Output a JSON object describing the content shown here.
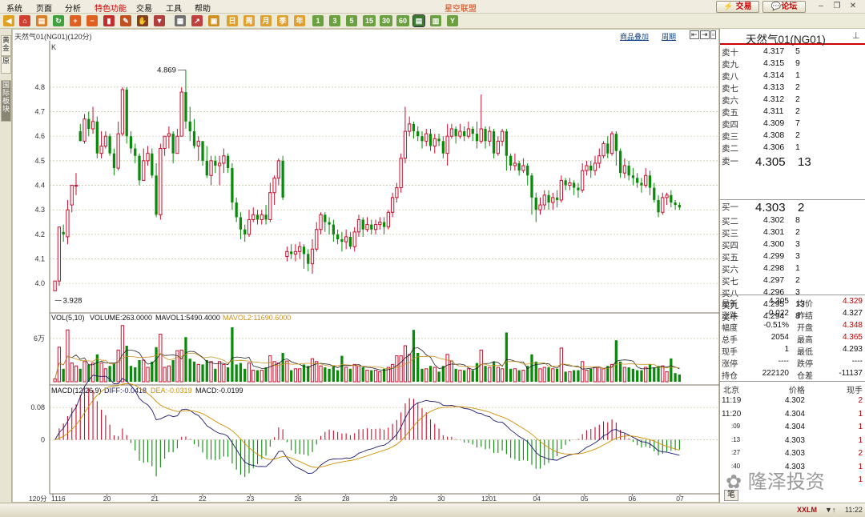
{
  "menu": [
    "系统",
    "页面",
    "分析",
    "特色功能",
    "交易",
    "工具",
    "帮助"
  ],
  "app_title": "星空联盟",
  "top_buttons": {
    "trade": "交易",
    "forum": "论坛"
  },
  "left_tabs": [
    "黄金",
    "原",
    "国际板块"
  ],
  "chart_header": {
    "title": "天然气01(NG01)(120分)",
    "overlay": "商品叠加",
    "period": "周期"
  },
  "toolbar_numbers": [
    "1",
    "3",
    "5",
    "15",
    "30",
    "60"
  ],
  "colors": {
    "up": "#c8102e",
    "down": "#0a8a0a",
    "bg": "#ffffff",
    "grid": "#c9c09a",
    "axis": "#7a7460"
  },
  "chart_data": [
    {
      "type": "candlestick",
      "title": "K",
      "ylim": [
        3.88,
        4.93
      ],
      "yticks": [
        4.0,
        4.1,
        4.2,
        4.3,
        4.4,
        4.5,
        4.6,
        4.7,
        4.8
      ],
      "annotations": {
        "high": "4.869",
        "low": "3.928"
      },
      "x_labels": [
        "1116",
        "20",
        "21",
        "22",
        "23",
        "26",
        "28",
        "29",
        "30",
        "1201",
        "04",
        "05",
        "06",
        "07"
      ],
      "bottom_label": "120分",
      "candles": [
        [
          3.97,
          4.01,
          3.93,
          3.93
        ],
        [
          4.01,
          4.23,
          3.99,
          4.21
        ],
        [
          4.21,
          4.2,
          4.17,
          4.24
        ],
        [
          4.19,
          4.3,
          4.16,
          4.34
        ],
        [
          4.32,
          4.4,
          4.29,
          4.4
        ],
        [
          4.4,
          4.4,
          4.36,
          4.45
        ],
        [
          4.62,
          4.58,
          4.58,
          4.65
        ],
        [
          4.58,
          4.67,
          4.57,
          4.69
        ],
        [
          4.67,
          4.63,
          4.6,
          4.7
        ],
        [
          4.63,
          4.66,
          4.61,
          4.72
        ],
        [
          4.66,
          4.53,
          4.51,
          4.68
        ],
        [
          4.53,
          4.56,
          4.51,
          4.62
        ],
        [
          4.56,
          4.6,
          4.55,
          4.62
        ],
        [
          4.6,
          4.53,
          4.52,
          4.61
        ],
        [
          4.53,
          4.47,
          4.44,
          4.55
        ],
        [
          4.47,
          4.61,
          4.46,
          4.66
        ],
        [
          4.61,
          4.79,
          4.6,
          4.8
        ],
        [
          4.79,
          4.6,
          4.57,
          4.8
        ],
        [
          4.6,
          4.55,
          4.53,
          4.62
        ],
        [
          4.55,
          4.52,
          4.49,
          4.57
        ],
        [
          4.52,
          4.42,
          4.4,
          4.53
        ],
        [
          4.42,
          4.5,
          4.42,
          4.55
        ],
        [
          4.5,
          4.53,
          4.48,
          4.56
        ],
        [
          4.53,
          4.44,
          4.43,
          4.55
        ],
        [
          4.44,
          4.28,
          4.27,
          4.49
        ],
        [
          4.28,
          4.55,
          4.26,
          4.57
        ],
        [
          4.55,
          4.6,
          4.52,
          4.6
        ],
        [
          4.6,
          4.61,
          4.55,
          4.64
        ],
        [
          4.61,
          4.53,
          4.49,
          4.62
        ],
        [
          4.53,
          4.6,
          4.53,
          4.63
        ],
        [
          4.6,
          4.78,
          4.6,
          4.8
        ],
        [
          4.78,
          4.66,
          4.63,
          4.87
        ],
        [
          4.66,
          4.62,
          4.58,
          4.72
        ],
        [
          4.62,
          4.56,
          4.55,
          4.67
        ],
        [
          4.56,
          4.58,
          4.5,
          4.6
        ],
        [
          4.58,
          4.5,
          4.48,
          4.58
        ],
        [
          4.5,
          4.44,
          4.43,
          4.56
        ],
        [
          4.44,
          4.5,
          4.4,
          4.52
        ],
        [
          4.5,
          4.48,
          4.45,
          4.52
        ],
        [
          4.48,
          4.49,
          4.4,
          4.52
        ],
        [
          4.49,
          4.52,
          4.45,
          4.55
        ],
        [
          4.52,
          4.47,
          4.45,
          4.53
        ],
        [
          4.47,
          4.33,
          4.3,
          4.49
        ],
        [
          4.33,
          4.27,
          4.25,
          4.35
        ],
        [
          4.27,
          4.22,
          4.18,
          4.29
        ],
        [
          4.22,
          4.2,
          4.17,
          4.24
        ],
        [
          4.2,
          4.26,
          4.19,
          4.3
        ],
        [
          4.26,
          4.28,
          4.25,
          4.31
        ],
        [
          4.28,
          4.26,
          4.24,
          4.3
        ],
        [
          4.26,
          4.28,
          4.24,
          4.3
        ],
        [
          4.28,
          4.26,
          4.24,
          4.32
        ],
        [
          4.26,
          4.37,
          4.25,
          4.41
        ],
        [
          4.37,
          4.43,
          4.32,
          4.44
        ],
        [
          4.43,
          4.5,
          4.4,
          4.51
        ],
        [
          4.5,
          4.35,
          4.34,
          4.52
        ],
        [
          4.11,
          4.13,
          4.09,
          4.15
        ],
        [
          4.13,
          4.12,
          4.1,
          4.16
        ],
        [
          4.12,
          4.13,
          4.09,
          4.16
        ],
        [
          4.13,
          4.15,
          4.1,
          4.17
        ],
        [
          4.15,
          4.12,
          4.06,
          4.16
        ],
        [
          4.12,
          4.08,
          4.05,
          4.14
        ],
        [
          4.08,
          4.14,
          4.04,
          4.18
        ],
        [
          4.14,
          4.22,
          4.13,
          4.25
        ],
        [
          4.22,
          4.28,
          4.2,
          4.29
        ],
        [
          4.28,
          4.25,
          4.21,
          4.29
        ],
        [
          4.25,
          4.24,
          4.2,
          4.27
        ],
        [
          4.24,
          4.2,
          4.17,
          4.26
        ],
        [
          4.2,
          4.18,
          4.16,
          4.22
        ],
        [
          4.18,
          4.17,
          4.13,
          4.21
        ],
        [
          4.17,
          4.19,
          4.14,
          4.22
        ],
        [
          4.19,
          4.15,
          4.14,
          4.21
        ],
        [
          4.15,
          4.21,
          4.13,
          4.23
        ],
        [
          4.21,
          4.26,
          4.19,
          4.28
        ],
        [
          4.26,
          4.22,
          4.19,
          4.27
        ],
        [
          4.22,
          4.24,
          4.21,
          4.27
        ],
        [
          4.24,
          4.22,
          4.2,
          4.26
        ],
        [
          4.22,
          4.24,
          4.2,
          4.26
        ],
        [
          4.24,
          4.25,
          4.22,
          4.27
        ],
        [
          4.25,
          4.23,
          4.2,
          4.27
        ],
        [
          4.23,
          4.29,
          4.22,
          4.3
        ],
        [
          4.29,
          4.35,
          4.27,
          4.37
        ],
        [
          4.35,
          4.39,
          4.33,
          4.41
        ],
        [
          4.39,
          4.51,
          4.37,
          4.53
        ],
        [
          4.51,
          4.62,
          4.49,
          4.72
        ],
        [
          4.62,
          4.65,
          4.6,
          4.68
        ],
        [
          4.65,
          4.62,
          4.59,
          4.66
        ],
        [
          4.62,
          4.6,
          4.58,
          4.64
        ],
        [
          4.6,
          4.58,
          4.55,
          4.62
        ],
        [
          4.58,
          4.61,
          4.56,
          4.63
        ],
        [
          4.61,
          4.56,
          4.54,
          4.63
        ],
        [
          4.56,
          4.59,
          4.53,
          4.61
        ],
        [
          4.59,
          4.58,
          4.56,
          4.61
        ],
        [
          4.58,
          4.53,
          4.51,
          4.6
        ],
        [
          4.53,
          4.6,
          4.48,
          4.65
        ],
        [
          4.6,
          4.63,
          4.59,
          4.65
        ],
        [
          4.63,
          4.6,
          4.57,
          4.64
        ],
        [
          4.6,
          4.62,
          4.59,
          4.65
        ],
        [
          4.62,
          4.6,
          4.58,
          4.64
        ],
        [
          4.6,
          4.63,
          4.59,
          4.66
        ],
        [
          4.63,
          4.61,
          4.58,
          4.64
        ],
        [
          4.61,
          4.58,
          4.55,
          4.66
        ],
        [
          4.58,
          4.63,
          4.57,
          4.77
        ],
        [
          4.63,
          4.58,
          4.55,
          4.64
        ],
        [
          4.58,
          4.62,
          4.56,
          4.64
        ],
        [
          4.62,
          4.53,
          4.51,
          4.63
        ],
        [
          4.53,
          4.58,
          4.52,
          4.6
        ],
        [
          4.58,
          4.62,
          4.56,
          4.63
        ],
        [
          4.62,
          4.52,
          4.46,
          4.63
        ],
        [
          4.52,
          4.48,
          4.46,
          4.53
        ],
        [
          4.48,
          4.49,
          4.46,
          4.53
        ],
        [
          4.49,
          4.46,
          4.44,
          4.5
        ],
        [
          4.46,
          4.48,
          4.45,
          4.51
        ],
        [
          4.48,
          4.44,
          4.4,
          4.49
        ],
        [
          4.44,
          4.35,
          4.28,
          4.45
        ],
        [
          4.35,
          4.3,
          4.25,
          4.37
        ],
        [
          4.3,
          4.32,
          4.28,
          4.35
        ],
        [
          4.32,
          4.36,
          4.3,
          4.38
        ],
        [
          4.36,
          4.33,
          4.3,
          4.38
        ],
        [
          4.33,
          4.35,
          4.3,
          4.37
        ],
        [
          4.35,
          4.34,
          4.31,
          4.38
        ],
        [
          4.34,
          4.42,
          4.33,
          4.44
        ],
        [
          4.42,
          4.4,
          4.38,
          4.43
        ],
        [
          4.4,
          4.41,
          4.38,
          4.43
        ],
        [
          4.41,
          4.39,
          4.36,
          4.42
        ],
        [
          4.39,
          4.38,
          4.35,
          4.41
        ],
        [
          4.38,
          4.46,
          4.37,
          4.49
        ],
        [
          4.46,
          4.48,
          4.44,
          4.5
        ],
        [
          4.48,
          4.46,
          4.43,
          4.5
        ],
        [
          4.46,
          4.49,
          4.44,
          4.52
        ],
        [
          4.49,
          4.52,
          4.47,
          4.55
        ],
        [
          4.52,
          4.57,
          4.51,
          4.58
        ],
        [
          4.57,
          4.53,
          4.51,
          4.6
        ],
        [
          4.53,
          4.61,
          4.52,
          4.62
        ],
        [
          4.61,
          4.54,
          4.48,
          4.62
        ],
        [
          4.54,
          4.45,
          4.43,
          4.55
        ],
        [
          4.45,
          4.48,
          4.43,
          4.51
        ],
        [
          4.48,
          4.44,
          4.42,
          4.5
        ],
        [
          4.44,
          4.43,
          4.4,
          4.47
        ],
        [
          4.43,
          4.41,
          4.39,
          4.45
        ],
        [
          4.41,
          4.4,
          4.37,
          4.43
        ],
        [
          4.4,
          4.44,
          4.39,
          4.47
        ],
        [
          4.44,
          4.39,
          4.36,
          4.46
        ],
        [
          4.39,
          4.34,
          4.33,
          4.41
        ],
        [
          4.34,
          4.29,
          4.27,
          4.36
        ],
        [
          4.29,
          4.35,
          4.28,
          4.37
        ],
        [
          4.35,
          4.36,
          4.32,
          4.37
        ],
        [
          4.36,
          4.33,
          4.31,
          4.38
        ],
        [
          4.33,
          4.32,
          4.3,
          4.34
        ],
        [
          4.32,
          4.31,
          4.3,
          4.33
        ]
      ]
    },
    {
      "type": "bar",
      "title": "VOL(5,10)",
      "legend": {
        "volume": "VOLUME:263.0000",
        "mavol1": "MAVOL1:5490.4000",
        "mavol2": "MAVOL2:11690.6000"
      },
      "ylim": [
        0,
        80000
      ],
      "yticks_label": "6万",
      "yticks_value": 60000,
      "series_colors": {
        "mavol1": "#222222",
        "mavol2": "#c89020"
      }
    },
    {
      "type": "bar",
      "title": "MACD(12,26,9)",
      "legend": {
        "diff": "DIFF:-0.0418",
        "dea": "DEA:-0.0319",
        "macd": "MACD:-0.0199"
      },
      "ylim": [
        -0.13,
        0.12
      ],
      "yticks": [
        "0.08",
        "0"
      ],
      "series_colors": {
        "diff": "#1a1a70",
        "dea": "#d09000"
      }
    }
  ],
  "right_panel": {
    "title": "天然气01(NG01)",
    "asks": [
      {
        "label": "卖十",
        "price": "4.317",
        "vol": "5"
      },
      {
        "label": "卖九",
        "price": "4.315",
        "vol": "9"
      },
      {
        "label": "卖八",
        "price": "4.314",
        "vol": "1"
      },
      {
        "label": "卖七",
        "price": "4.313",
        "vol": "2"
      },
      {
        "label": "卖六",
        "price": "4.312",
        "vol": "2"
      },
      {
        "label": "卖五",
        "price": "4.311",
        "vol": "2"
      },
      {
        "label": "卖四",
        "price": "4.309",
        "vol": "7"
      },
      {
        "label": "卖三",
        "price": "4.308",
        "vol": "2"
      },
      {
        "label": "卖二",
        "price": "4.306",
        "vol": "1"
      },
      {
        "label": "卖一",
        "price": "4.305",
        "vol": "13"
      }
    ],
    "bids": [
      {
        "label": "买一",
        "price": "4.303",
        "vol": "2"
      },
      {
        "label": "买二",
        "price": "4.302",
        "vol": "8"
      },
      {
        "label": "买三",
        "price": "4.301",
        "vol": "2"
      },
      {
        "label": "买四",
        "price": "4.300",
        "vol": "3"
      },
      {
        "label": "买五",
        "price": "4.299",
        "vol": "3"
      },
      {
        "label": "买六",
        "price": "4.298",
        "vol": "1"
      },
      {
        "label": "买七",
        "price": "4.297",
        "vol": "2"
      },
      {
        "label": "买八",
        "price": "4.296",
        "vol": "3"
      },
      {
        "label": "买九",
        "price": "4.295",
        "vol": "13"
      },
      {
        "label": "买十",
        "price": "4.294",
        "vol": "8"
      }
    ],
    "quote": [
      {
        "l1": "最新",
        "v1": "4.305",
        "c1": "#111",
        "l2": "均价",
        "v2": "4.329",
        "c2": "#c00000"
      },
      {
        "l1": "涨跌",
        "v1": "-0.022",
        "c1": "#111",
        "l2": "昨结",
        "v2": "4.327",
        "c2": "#111"
      },
      {
        "l1": "幅度",
        "v1": "-0.51%",
        "c1": "#111",
        "l2": "开盘",
        "v2": "4.348",
        "c2": "#c00000"
      },
      {
        "l1": "总手",
        "v1": "2054",
        "c1": "#111",
        "l2": "最高",
        "v2": "4.365",
        "c2": "#c00000"
      },
      {
        "l1": "现手",
        "v1": "1",
        "c1": "#111",
        "l2": "最低",
        "v2": "4.293",
        "c2": "#111"
      },
      {
        "l1": "涨停",
        "v1": "----",
        "c1": "#111",
        "l2": "跌停",
        "v2": "----",
        "c2": "#111"
      },
      {
        "l1": "持仓",
        "v1": "222120",
        "c1": "#111",
        "l2": "仓差",
        "v2": "-11137",
        "c2": "#111"
      }
    ],
    "ticks_header": {
      "time": "北京",
      "price": "价格",
      "vol": "现手"
    },
    "ticks": [
      {
        "time": "11:19",
        "price": "4.302",
        "vol": "2"
      },
      {
        "time": "11:20",
        "price": "4.304",
        "vol": "1"
      },
      {
        "time": ":09",
        "price": "4.304",
        "vol": "1"
      },
      {
        "time": ":13",
        "price": "4.303",
        "vol": "1"
      },
      {
        "time": ":27",
        "price": "4.303",
        "vol": "2"
      },
      {
        "time": ":40",
        "price": "4.303",
        "vol": "1"
      },
      {
        "time": "",
        "price": "",
        "vol": "1"
      }
    ],
    "footer_tab": "笔"
  },
  "status": {
    "brand": "XXLM",
    "time": "11:22"
  },
  "watermark": "隆泽投资"
}
